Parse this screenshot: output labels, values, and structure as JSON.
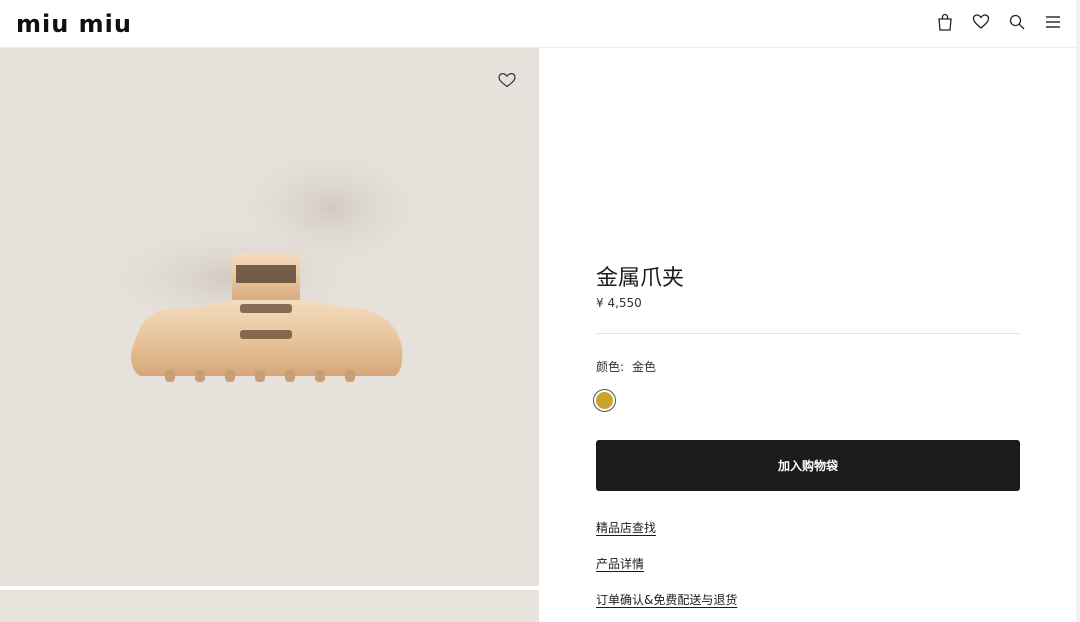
{
  "header": {
    "logo_text": "miu miu",
    "icons": [
      "shopping-bag-icon",
      "heart-icon",
      "search-icon",
      "menu-icon"
    ]
  },
  "product": {
    "name": "金属爪夹",
    "price": "¥ 4,550",
    "color_label": "颜色:",
    "color_value": "金色",
    "swatch_color": "#c9a32a",
    "add_to_bag_label": "加入购物袋"
  },
  "links": {
    "store_finder": "精品店查找",
    "product_details": "产品详情",
    "order_shipping_returns": "订单确认&免费配送与退货"
  },
  "colors": {
    "image_bg": "#e6e1da",
    "button_bg": "#1b1b1b",
    "product_gold": "#e8c9a0"
  }
}
